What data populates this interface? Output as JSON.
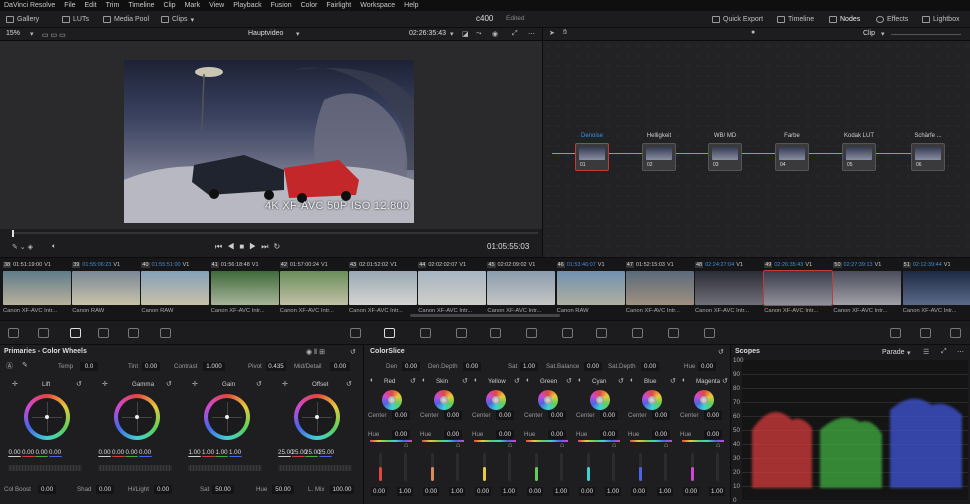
{
  "menu": [
    "DaVinci Resolve",
    "File",
    "Edit",
    "Trim",
    "Timeline",
    "Clip",
    "Mark",
    "View",
    "Playback",
    "Fusion",
    "Color",
    "Fairlight",
    "Workspace",
    "Help"
  ],
  "pagebar": {
    "gallery": "Gallery",
    "luts": "LUTs",
    "media_pool": "Media Pool",
    "clips": "Clips",
    "project": "c400",
    "status": "Edited",
    "quick_export": "Quick Export",
    "timeline": "Timeline",
    "nodes": "Nodes",
    "effects": "Effects",
    "lightbox": "Lightbox"
  },
  "viewer": {
    "zoom": "15%",
    "timeline_name": "Hauptvideo",
    "timecode": "02:26:35:43",
    "overlay": "4K XF-AVC 50P ISO 12.800",
    "playhead_tc": "01:05:55:03"
  },
  "nodes_hdr": {
    "mode": "Clip"
  },
  "nodes": [
    {
      "label": "Denoise",
      "num": "01"
    },
    {
      "label": "Helligkeit",
      "num": "02"
    },
    {
      "label": "WB/ MD",
      "num": "03"
    },
    {
      "label": "Farbe",
      "num": "04"
    },
    {
      "label": "Kodak LUT",
      "num": "05"
    },
    {
      "label": "Schärfe ...",
      "num": "06"
    }
  ],
  "clips": [
    {
      "n": "38",
      "tc": "01:51:19:00",
      "track": "V1",
      "cap": "Canon XF-AVC Intr...",
      "blue": false
    },
    {
      "n": "39",
      "tc": "01:55:06:23",
      "track": "V1",
      "cap": "Canon RAW",
      "blue": true
    },
    {
      "n": "40",
      "tc": "01:55:51:00",
      "track": "V1",
      "cap": "Canon RAW",
      "blue": true
    },
    {
      "n": "41",
      "tc": "01:56:18:48",
      "track": "V1",
      "cap": "Canon XF-AVC Intr...",
      "blue": false
    },
    {
      "n": "42",
      "tc": "01:57:00:24",
      "track": "V1",
      "cap": "Canon XF-AVC Intr...",
      "blue": false
    },
    {
      "n": "43",
      "tc": "02:01:52:02",
      "track": "V1",
      "cap": "Canon XF-AVC Intr...",
      "blue": false
    },
    {
      "n": "44",
      "tc": "02:02:02:07",
      "track": "V1",
      "cap": "Canon XF-AVC Intr...",
      "blue": false
    },
    {
      "n": "45",
      "tc": "02:02:09:02",
      "track": "V1",
      "cap": "Canon XF-AVC Intr...",
      "blue": false
    },
    {
      "n": "46",
      "tc": "01:53:46:07",
      "track": "V1",
      "cap": "Canon RAW",
      "blue": true
    },
    {
      "n": "47",
      "tc": "01:52:15:03",
      "track": "V1",
      "cap": "Canon XF-AVC Intr...",
      "blue": false
    },
    {
      "n": "48",
      "tc": "02:24:27:04",
      "track": "V1",
      "cap": "Canon XF-AVC Intr...",
      "blue": true
    },
    {
      "n": "49",
      "tc": "02:26:35:43",
      "track": "V1",
      "cap": "Canon XF-AVC Intr...",
      "blue": true
    },
    {
      "n": "50",
      "tc": "02:27:39:13",
      "track": "V1",
      "cap": "Canon XF-AVC Intr...",
      "blue": true
    },
    {
      "n": "51",
      "tc": "02:12:39:44",
      "track": "V1",
      "cap": "Canon XF-AVC Intr...",
      "blue": true
    }
  ],
  "primaries": {
    "title": "Primaries - Color Wheels",
    "temp_label": "Temp",
    "temp": "0.0",
    "tint_label": "Tint",
    "tint": "0.00",
    "contrast_label": "Contrast",
    "contrast": "1.000",
    "pivot_label": "Pivot",
    "pivot": "0.435",
    "mid_label": "Mid/Detail",
    "mid": "0.00",
    "wheels": [
      {
        "name": "Lift",
        "vals": [
          "0.00",
          "0.00",
          "0.00",
          "0.00"
        ]
      },
      {
        "name": "Gamma",
        "vals": [
          "0.00",
          "0.00",
          "0.00",
          "0.00"
        ]
      },
      {
        "name": "Gain",
        "vals": [
          "1.00",
          "1.00",
          "1.00",
          "1.00"
        ]
      },
      {
        "name": "Offset",
        "vals": [
          "25.00",
          "25.00",
          "25.00",
          "25.00"
        ]
      }
    ],
    "colboost_label": "Col Boost",
    "colboost": "0.00",
    "shad_label": "Shad",
    "shad": "0.00",
    "hilight_label": "Hi/Light",
    "hilight": "0.00",
    "sat_label": "Sat",
    "sat": "50.00",
    "hue_label": "Hue",
    "hue": "50.00",
    "lmix_label": "L. Mix",
    "lmix": "100.00"
  },
  "colorslice": {
    "title": "ColorSlice",
    "den_label": "Den",
    "den": "0.00",
    "dendepth_label": "Den.Depth",
    "dendepth": "0.00",
    "sat_label": "Sat",
    "sat": "1.00",
    "satbal_label": "Sat.Balance",
    "satbal": "0.00",
    "satdepth_label": "Sat.Depth",
    "satdepth": "0.00",
    "hue_label": "Hue",
    "hue": "0.00",
    "center_label": "Center",
    "hue_row_label": "Hue",
    "slices": [
      {
        "name": "Red",
        "center": "0.00",
        "hue": "0.00",
        "a": "0.00",
        "b": "1.00",
        "color": "#e2463f"
      },
      {
        "name": "Skin",
        "center": "0.00",
        "hue": "0.00",
        "a": "0.00",
        "b": "1.00",
        "color": "#d98a5a"
      },
      {
        "name": "Yellow",
        "center": "0.00",
        "hue": "0.00",
        "a": "0.00",
        "b": "1.00",
        "color": "#e6c93c"
      },
      {
        "name": "Green",
        "center": "0.00",
        "hue": "0.00",
        "a": "0.00",
        "b": "1.00",
        "color": "#5fd05a"
      },
      {
        "name": "Cyan",
        "center": "0.00",
        "hue": "0.00",
        "a": "0.00",
        "b": "1.00",
        "color": "#3fd1d0"
      },
      {
        "name": "Blue",
        "center": "0.00",
        "hue": "0.00",
        "a": "0.00",
        "b": "1.00",
        "color": "#4a66e6"
      },
      {
        "name": "Magenta",
        "center": "0.00",
        "hue": "0.00",
        "a": "0.00",
        "b": "1.00",
        "color": "#d048d0"
      }
    ]
  },
  "scopes": {
    "title": "Scopes",
    "mode": "Parade",
    "y_labels": [
      "100",
      "90",
      "80",
      "70",
      "60",
      "50",
      "40",
      "30",
      "20",
      "10",
      "0"
    ]
  }
}
